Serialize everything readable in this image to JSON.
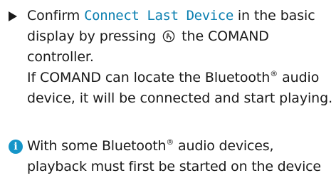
{
  "step": {
    "prefix": "Confirm ",
    "menu_item": "Connect Last Device",
    "middle": " in the basic display by pressing ",
    "controller_icon": "controller-press-icon",
    "suffix": " the COMAND controller.",
    "result_a": "If COMAND can locate the Bluetooth",
    "result_reg": "®",
    "result_b": " audio device, it will be connected and start playing."
  },
  "note": {
    "icon": "info-icon",
    "icon_glyph": "i",
    "text_a": "With some Bluetooth",
    "text_reg": "®",
    "text_b": " audio devices, playback must first be started on the device"
  },
  "colors": {
    "menu_item": "#0a7fb0",
    "info_icon": "#1595c8",
    "text": "#1a1a1a"
  }
}
